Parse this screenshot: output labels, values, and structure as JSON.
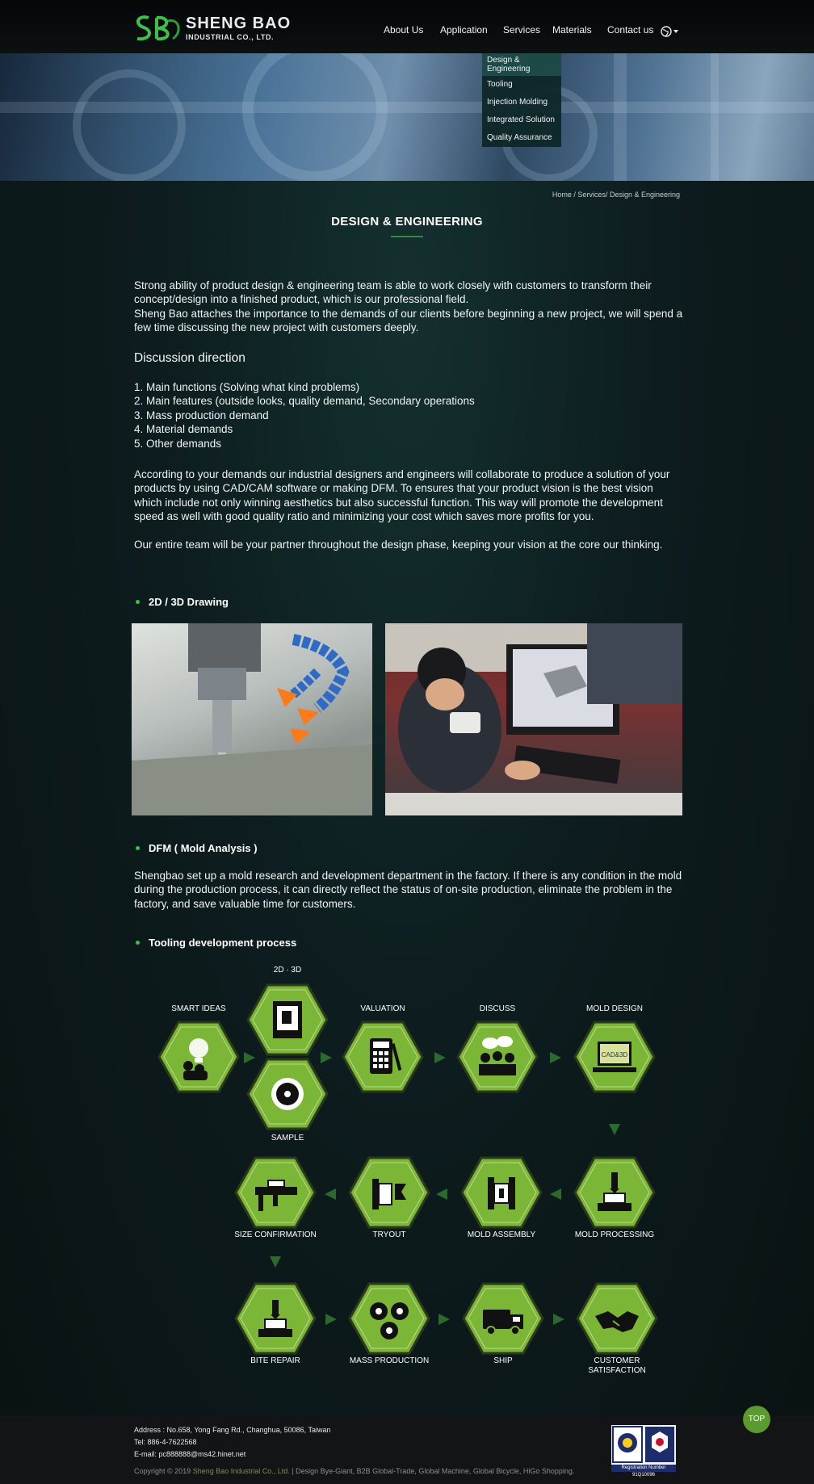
{
  "header": {
    "logo_name": "SHENG BAO",
    "logo_sub": "INDUSTRIAL CO., LTD.",
    "nav": [
      "About Us",
      "Application",
      "Services",
      "Materials",
      "Contact us"
    ],
    "dropdown": [
      "Design & Engineering",
      "Tooling",
      "Injection Molding",
      "Integrated Solution",
      "Quality Assurance"
    ]
  },
  "breadcrumb": "Home / Services/ Design & Engineering",
  "page_title": "DESIGN & ENGINEERING",
  "intro": {
    "p1": "Strong ability of product design & engineering team is able to work closely with customers to transform their concept/design into a finished product, which is our professional field.",
    "p2": "Sheng Bao attaches the importance to the demands of our clients before beginning a new project, we will spend a few time discussing the new project with customers deeply."
  },
  "discussion": {
    "heading": "Discussion direction",
    "items": [
      "1.  Main functions (Solving what kind problems)",
      "2.  Main features (outside looks, quality demand, Secondary operations",
      "3.  Mass production demand",
      "4.  Material demands",
      "5.  Other demands"
    ]
  },
  "body": {
    "p3": "According to your demands our industrial designers and engineers will collaborate to produce a solution of your products by using CAD/CAM software or making DFM. To ensures that your product vision is the best vision which include not only winning aesthetics but also successful function.  This way will promote the development speed as well with good quality ratio and minimizing your cost which saves more profits for you.",
    "p4": "Our entire team will be your partner throughout the design phase, keeping your vision at the core our thinking."
  },
  "sections": {
    "drawing": "2D / 3D Drawing",
    "dfm": "DFM ( Mold Analysis )",
    "dfm_text": "Shengbao set up a mold research and development department in the factory. If there is any condition in the mold during the production process, it can directly reflect the status of on-site production, eliminate the problem in the factory, and save valuable time for customers.",
    "tooling": "Tooling development process"
  },
  "process": {
    "smart_ideas": "SMART IDEAS",
    "d2d3": "2D · 3D",
    "sample": "SAMPLE",
    "valuation": "VALUATION",
    "discuss": "DISCUSS",
    "mold_design": "MOLD DESIGN",
    "cad_text": "CAD&3D",
    "mold_processing": "MOLD PROCESSING",
    "mold_assembly": "MOLD ASSEMBLY",
    "tryout": "TRYOUT",
    "size_confirmation": "SIZE CONFIRMATION",
    "bite_repair": "BITE REPAIR",
    "mass_production": "MASS PRODUCTION",
    "ship": "SHIP",
    "customer_satisfaction": "CUSTOMER SATISFACTION"
  },
  "footer": {
    "address": "Address : No.658, Yong Fang Rd., Changhua, 50086, Taiwan",
    "tel": "Tel: 886-4-7622568",
    "email": "E-mail: pc888888@ms42.hinet.net",
    "copyright_prefix": "Copyright ©  2019 ",
    "company": "Sheng Bao Industrial Co., Ltd.",
    "design": " | Design Bye-Giant, B2B Global-Trade, Global Machine, Global Bicycle, HiGo Shopping.",
    "cert_reg": "Registration Number 91Q10096"
  },
  "top_label": "TOP",
  "colors": {
    "accent": "#2e8b3a",
    "hex_fill": "#7cb636",
    "hex_border": "#2a3a1a",
    "background": "#0b1416"
  }
}
